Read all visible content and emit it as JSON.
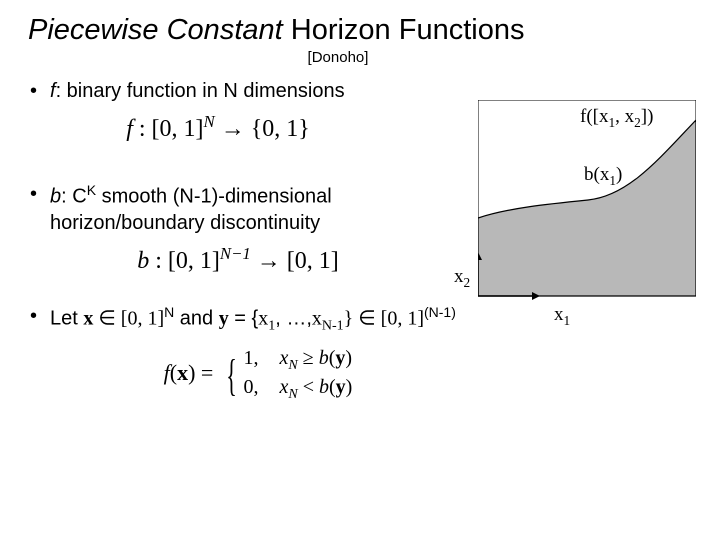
{
  "title": {
    "italic_part": "Piecewise Constant",
    "rest": " Horizon Functions"
  },
  "attribution": "[Donoho]",
  "bullets": {
    "b1_prefix": "f",
    "b1_rest": ": binary function in N dimensions",
    "b2_prefix": "b",
    "b2_mid": ": C",
    "b2_sup": "K",
    "b2_rest": " smooth (N-1)-dimensional horizon/boundary discontinuity",
    "b3_pre": "Let ",
    "b3_x": "x",
    "b3_in1": " ∈ [0, 1]",
    "b3_n": "N",
    "b3_and": " and ",
    "b3_y": "y",
    "b3_eq": " = {",
    "b3_x1": "x",
    "b3_x1sub": "1",
    "b3_dots": ", …,",
    "b3_xn": "x",
    "b3_xnsub": "N-1",
    "b3_close": "} ∈ [0, 1]",
    "b3_exp": "(N-1)"
  },
  "formulas": {
    "f": "f : [0, 1]ᴺ → {0, 1}",
    "b": "b : [0, 1]ᴺ⁻¹ → [0, 1]",
    "piece_lhs": "f(x) = ",
    "case1_val": "1,",
    "case1_cond": "xₙ ≥ b(y)",
    "case2_val": "0,",
    "case2_cond": "xₙ < b(y)"
  },
  "figure": {
    "f_label_pre": "f([x",
    "f_label_s1": "1",
    "f_label_mid": ", x",
    "f_label_s2": "2",
    "f_label_post": "])",
    "b_label_pre": "b(x",
    "b_label_s": "1",
    "b_label_post": ")",
    "x1_pre": "x",
    "x1_sub": "1",
    "x2_pre": "x",
    "x2_sub": "2"
  },
  "chart_data": {
    "type": "area",
    "title": "f([x1, x2])",
    "xlabel": "x1",
    "ylabel": "x2",
    "xlim": [
      0,
      1
    ],
    "ylim": [
      0,
      1
    ],
    "annotations": [
      "b(x1)"
    ],
    "series": [
      {
        "name": "b(x1)",
        "x": [
          0.0,
          0.1,
          0.2,
          0.3,
          0.4,
          0.5,
          0.6,
          0.7,
          0.8,
          0.9,
          1.0
        ],
        "values": [
          0.4,
          0.44,
          0.46,
          0.47,
          0.48,
          0.5,
          0.54,
          0.62,
          0.72,
          0.82,
          0.9
        ]
      }
    ]
  }
}
